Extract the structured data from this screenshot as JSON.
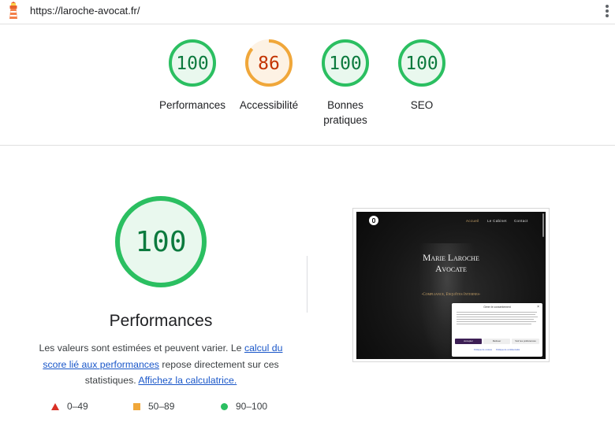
{
  "topbar": {
    "url": "https://laroche-avocat.fr/",
    "logo_icon": "lighthouse-icon",
    "menu_icon": "kebab-menu-icon"
  },
  "colors": {
    "pass": "#0c7a3e",
    "pass_ring": "#2bbf61",
    "pass_fill": "#e9f8ee",
    "average": "#c33300",
    "average_ring": "#f0a73a",
    "average_fill": "#fdf2e4",
    "fail": "#d93025"
  },
  "summary": {
    "gauges": [
      {
        "score": "100",
        "label": "Performances",
        "value": 1.0,
        "status": "pass"
      },
      {
        "score": "86",
        "label": "Accessibilité",
        "value": 0.86,
        "status": "average"
      },
      {
        "score": "100",
        "label": "Bonnes pratiques",
        "value": 1.0,
        "status": "pass"
      },
      {
        "score": "100",
        "label": "SEO",
        "value": 1.0,
        "status": "pass"
      }
    ]
  },
  "detail": {
    "score": "100",
    "value": 1.0,
    "title": "Performances",
    "desc_pre": "Les valeurs sont estimées et peuvent varier. Le ",
    "desc_link1": "calcul du score lié aux performances",
    "desc_mid": " repose directement sur ces statistiques. ",
    "desc_link2": "Affichez la calculatrice.",
    "legend": [
      {
        "range": "0–49",
        "shape": "triangle"
      },
      {
        "range": "50–89",
        "shape": "square"
      },
      {
        "range": "90–100",
        "shape": "circle"
      }
    ]
  },
  "screenshot": {
    "nav": [
      "Accueil",
      "Le Cabinet",
      "Contact"
    ],
    "heading_line1": "Marie Laroche",
    "heading_line2": "Avocate",
    "tagline": "-Compliance, Enquêtes Internes-",
    "consent_title": "Gérer le consentement",
    "consent_accept": "Accepter",
    "consent_refuse": "Refuser",
    "consent_prefs": "Voir les préférences",
    "consent_link1": "Politique de cookies",
    "consent_link2": "Politique de confidentialité"
  }
}
